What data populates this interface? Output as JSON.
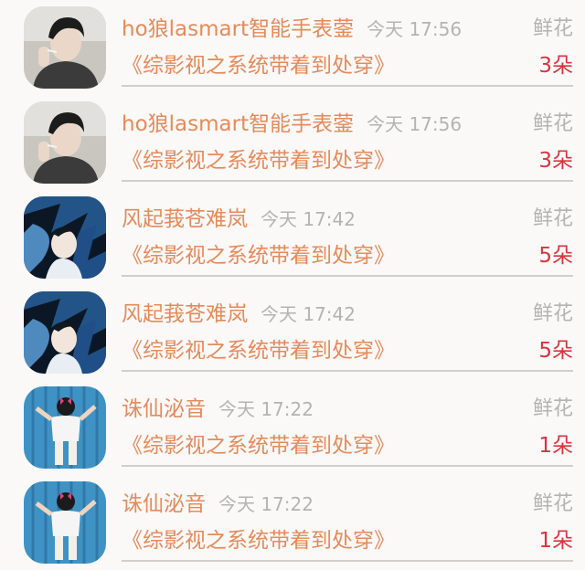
{
  "records": [
    {
      "user": "ho狼lasmart智能手表蓥",
      "time": "今天 17:56",
      "gift_type": "鲜花",
      "book": "《综影视之系统带着到处穿》",
      "count": "3朵",
      "avatar_icon": "boy-smoking-avatar"
    },
    {
      "user": "ho狼lasmart智能手表蓥",
      "time": "今天 17:56",
      "gift_type": "鲜花",
      "book": "《综影视之系统带着到处穿》",
      "count": "3朵",
      "avatar_icon": "boy-smoking-avatar"
    },
    {
      "user": "风起莪苍难岚",
      "time": "今天 17:42",
      "gift_type": "鲜花",
      "book": "《综影视之系统带着到处穿》",
      "count": "5朵",
      "avatar_icon": "anime-blue-avatar"
    },
    {
      "user": "风起莪苍难岚",
      "time": "今天 17:42",
      "gift_type": "鲜花",
      "book": "《综影视之系统带着到处穿》",
      "count": "5朵",
      "avatar_icon": "anime-blue-avatar"
    },
    {
      "user": "诛仙泌音",
      "time": "今天 17:22",
      "gift_type": "鲜花",
      "book": "《综影视之系统带着到处穿》",
      "count": "1朵",
      "avatar_icon": "girl-wall-avatar"
    },
    {
      "user": "诛仙泌音",
      "time": "今天 17:22",
      "gift_type": "鲜花",
      "book": "《综影视之系统带着到处穿》",
      "count": "1朵",
      "avatar_icon": "girl-wall-avatar"
    }
  ],
  "colors": {
    "accent": "#e58a5a",
    "count": "#d9333f",
    "muted": "#b3b3b3",
    "divider": "#cfcfcf",
    "background": "#fbf9f8"
  }
}
